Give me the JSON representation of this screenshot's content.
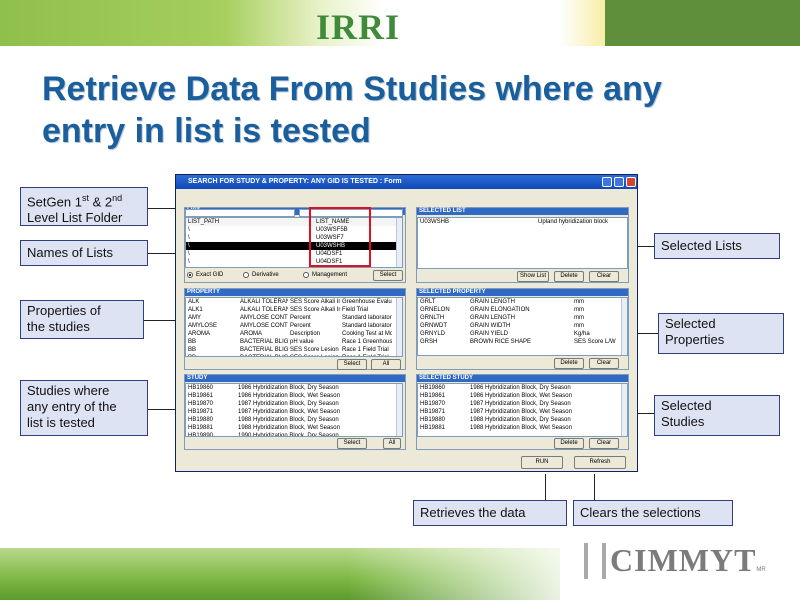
{
  "header": {
    "logo": "IRRI",
    "title_line1": "Retrieve Data From Studies where any",
    "title_line2": "entry in list is tested"
  },
  "footer": {
    "logo": "CIMMYT",
    "logo_mark": "MR"
  },
  "callouts": {
    "folder_a": "SetGen 1",
    "folder_sup1": "st",
    "folder_b": " & 2",
    "folder_sup2": "nd",
    "folder_c": "Level List Folder",
    "names_of_lists": "Names of Lists",
    "properties_1": "Properties of",
    "properties_2": "the studies",
    "studies_1": "Studies where",
    "studies_2": "any entry of the",
    "studies_3": "list is tested",
    "selected_lists": "Selected Lists",
    "selected_properties_1": "Selected",
    "selected_properties_2": "Properties",
    "selected_studies_1": "Selected",
    "selected_studies_2": "Studies",
    "retrieves": "Retrieves the data",
    "clears": "Clears the selections"
  },
  "window": {
    "title": "SEARCH FOR STUDY & PROPERTY:  ANY GID IS TESTED : Form",
    "list_panel": {
      "title": "LIST",
      "col_path": "LIST_PATH",
      "col_name": "LIST_NAME",
      "paths": [
        "\\",
        "\\",
        "\\",
        "\\",
        "\\",
        "\\"
      ],
      "names": [
        "U03WSF5B",
        "U03WSF7",
        "U03WSHB",
        "U04DSF1",
        "U04DSF1"
      ],
      "selected_index": 2,
      "radio_exact": "Exact GID",
      "radio_derivative": "Derivative",
      "radio_management": "Management",
      "select_btn": "Select"
    },
    "selected_list_panel": {
      "title": "SELECTED LIST",
      "item_name": "U03WSHB",
      "item_desc": "Upland hybridization block",
      "show_list_btn": "Show List",
      "delete_btn": "Delete",
      "clear_btn": "Clear"
    },
    "property_panel": {
      "title": "PROPERTY",
      "rows": [
        [
          "ALK",
          "ALKALI TOLERANCE",
          "SES Score Alkali Inj",
          "Greenhouse Evaluat"
        ],
        [
          "ALK1",
          "ALKALI TOLERANCE",
          "SES Score Alkali Inj",
          "Field Trial"
        ],
        [
          "AMY",
          "AMYLOSE CONTENT",
          "Percent",
          "Standard laborator"
        ],
        [
          "AMYLOSE",
          "AMYLOSE CONTENT",
          "Percent",
          "Standard laborator"
        ],
        [
          "AROMA",
          "AROMA",
          "Description",
          "Cooking Test at Mo"
        ],
        [
          "BB",
          "BACTERIAL BLIGHT",
          "pH value",
          "Race 1 Greenhouse"
        ],
        [
          "BB",
          "BACTERIAL BLIGHT",
          "SES Score Lesion A",
          "Race 1 Field Trial"
        ],
        [
          "BB",
          "BACTERIAL BLIGHT",
          "SES Score Lesion A",
          "Race 1 Field Trial"
        ]
      ],
      "select_btn": "Select",
      "all_btn": "All"
    },
    "selected_property_panel": {
      "title": "SELECTED PROPERTY",
      "rows": [
        [
          "GRLT",
          "GRAIN LENGTH",
          "mm"
        ],
        [
          "GRNELON",
          "GRAIN ELONGATION",
          "mm"
        ],
        [
          "GRNLTH",
          "GRAIN LENGTH",
          "mm"
        ],
        [
          "GRNWDT",
          "GRAIN WIDTH",
          "mm"
        ],
        [
          "GRNYLD",
          "GRAIN YIELD",
          "Kg/ha"
        ],
        [
          "GRSH",
          "BROWN RICE SHAPE",
          "SES Score L/W"
        ]
      ],
      "delete_btn": "Delete",
      "clear_btn": "Clear"
    },
    "study_panel": {
      "title": "STUDY",
      "rows": [
        [
          "HB19860",
          "1986 Hybridization Block,  Dry Season"
        ],
        [
          "HB19861",
          "1986 Hybridization Block,  Wet Season"
        ],
        [
          "HB19870",
          "1987 Hybridization Block,  Dry Season"
        ],
        [
          "HB19871",
          "1987 Hybridization Block,  Wet Season"
        ],
        [
          "HB19880",
          "1988 Hybridization Block,  Dry Season"
        ],
        [
          "HB19881",
          "1988 Hybridization Block,  Wet Season"
        ],
        [
          "HB19890",
          "1990 Hybridization Block,  Dry Season"
        ]
      ],
      "select_btn": "Select",
      "all_btn": "All"
    },
    "selected_study_panel": {
      "title": "SELECTED STUDY",
      "rows": [
        [
          "HB19860",
          "1986 Hybridization Block,  Dry Season"
        ],
        [
          "HB19861",
          "1986 Hybridization Block,  Wet Season"
        ],
        [
          "HB19870",
          "1987 Hybridization Block,  Dry Season"
        ],
        [
          "HB19871",
          "1987 Hybridization Block,  Wet Season"
        ],
        [
          "HB19880",
          "1988 Hybridization Block,  Dry Season"
        ],
        [
          "HB19881",
          "1988 Hybridization Block,  Wet Season"
        ]
      ],
      "delete_btn": "Delete",
      "clear_btn": "Clear"
    },
    "run_btn": "RUN",
    "refresh_btn": "Refresh"
  }
}
